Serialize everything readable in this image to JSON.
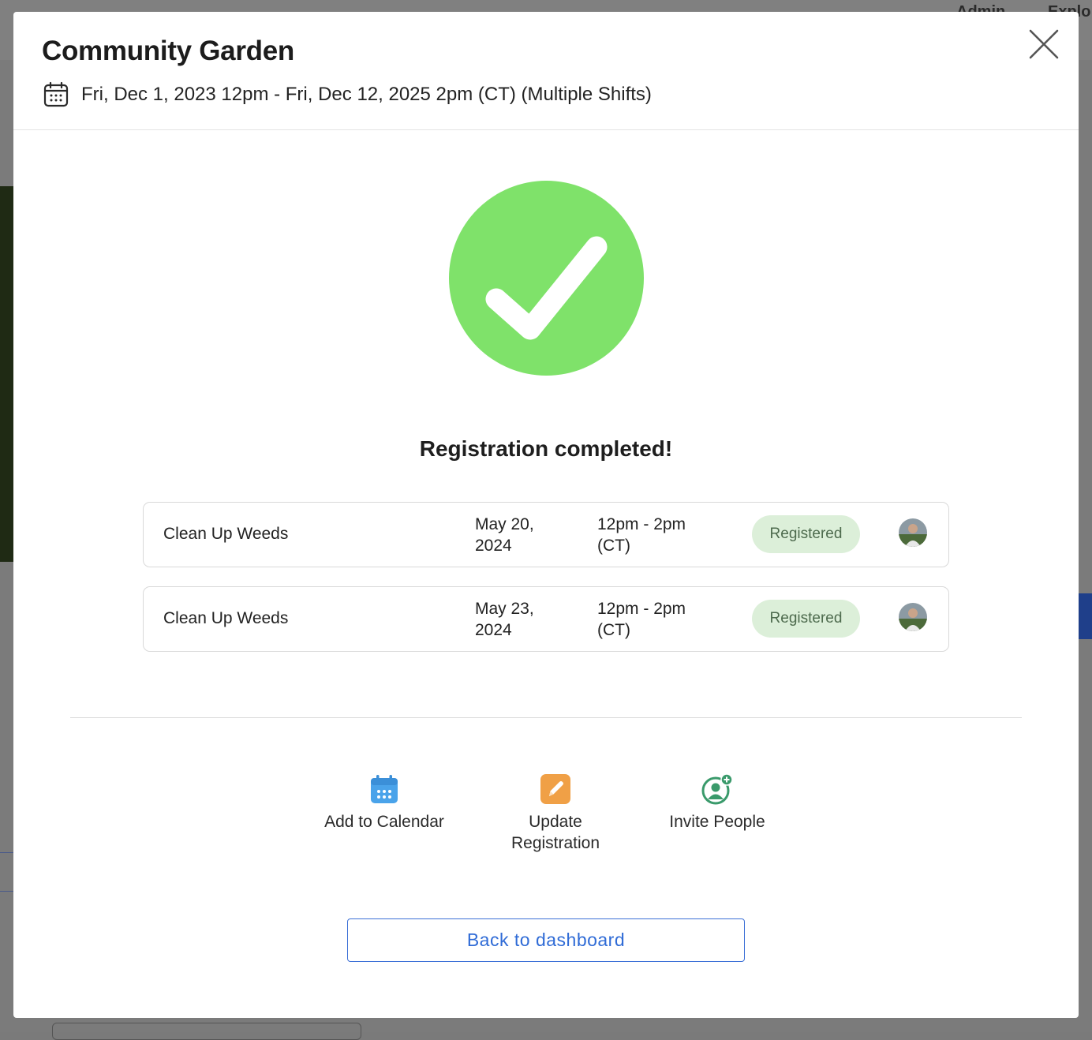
{
  "background_page": {
    "nav_items": [
      "Admin",
      "Explo"
    ]
  },
  "modal": {
    "title": "Community Garden",
    "date_range": "Fri, Dec 1, 2023 12pm - Fri, Dec 12, 2025 2pm (CT) (Multiple Shifts)",
    "close_icon": "close-icon",
    "success_icon": "check-circle-icon",
    "success_color": "#7fe26a",
    "success_message": "Registration completed!",
    "shifts": [
      {
        "name": "Clean Up Weeds",
        "date": "May 20, 2024",
        "time": "12pm - 2pm (CT)",
        "status": "Registered"
      },
      {
        "name": "Clean Up Weeds",
        "date": "May 23, 2024",
        "time": "12pm - 2pm (CT)",
        "status": "Registered"
      }
    ],
    "actions": [
      {
        "label": "Add to Calendar",
        "icon": "calendar-icon",
        "color": "#4aa3ea"
      },
      {
        "label": "Update Registration",
        "icon": "edit-pencil-icon",
        "color": "#f0a046"
      },
      {
        "label": "Invite People",
        "icon": "invite-person-icon",
        "color": "#3a9a6b"
      }
    ],
    "back_button_label": "Back to dashboard",
    "colors": {
      "badge_bg": "#dcefd9",
      "badge_text": "#4d6a4d",
      "link_blue": "#2f6bd6"
    }
  }
}
